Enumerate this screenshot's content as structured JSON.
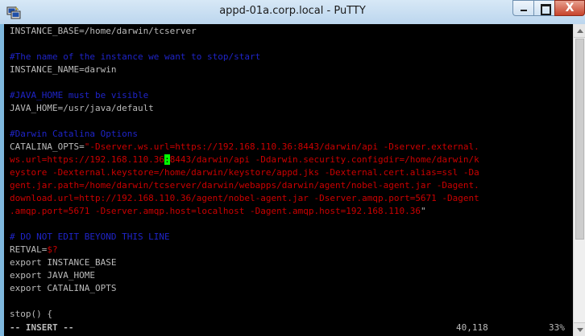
{
  "window": {
    "title": "appd-01a.corp.local - PuTTY",
    "icon": "putty-icon",
    "close_label": "X"
  },
  "terminal": {
    "lines": [
      {
        "segments": [
          {
            "cls": "w",
            "text": "INSTANCE_BASE=/home/darwin/tcserver"
          }
        ]
      },
      {
        "segments": []
      },
      {
        "segments": [
          {
            "cls": "c",
            "text": "#The name of the instance we want to stop/start"
          }
        ]
      },
      {
        "segments": [
          {
            "cls": "w",
            "text": "INSTANCE_NAME=darwin"
          }
        ]
      },
      {
        "segments": []
      },
      {
        "segments": [
          {
            "cls": "c",
            "text": "#JAVA_HOME must be visible"
          }
        ]
      },
      {
        "segments": [
          {
            "cls": "w",
            "text": "JAVA_HOME=/usr/java/default"
          }
        ]
      },
      {
        "segments": []
      },
      {
        "segments": [
          {
            "cls": "c",
            "text": "#Darwin Catalina Options"
          }
        ]
      },
      {
        "segments": [
          {
            "cls": "w",
            "text": "CATALINA_OPTS="
          },
          {
            "cls": "r",
            "text": "\"-Dserver.ws.url=https://192.168.110.36:8443/darwin/api -Dserver.external."
          }
        ]
      },
      {
        "segments": [
          {
            "cls": "r",
            "text": "ws.url=https://192.168.110.36"
          },
          {
            "cls": "cursor",
            "text": ":"
          },
          {
            "cls": "r",
            "text": "8443/darwin/api -Ddarwin.security.configdir=/home/darwin/k"
          }
        ]
      },
      {
        "segments": [
          {
            "cls": "r",
            "text": "eystore -Dexternal.keystore=/home/darwin/keystore/appd.jks -Dexternal.cert.alias=ssl -Da"
          }
        ]
      },
      {
        "segments": [
          {
            "cls": "r",
            "text": "gent.jar.path=/home/darwin/tcserver/darwin/webapps/darwin/agent/nobel-agent.jar -Dagent."
          }
        ]
      },
      {
        "segments": [
          {
            "cls": "r",
            "text": "download.url=http://192.168.110.36/agent/nobel-agent.jar -Dserver.amqp.port=5671 -Dagent"
          }
        ]
      },
      {
        "segments": [
          {
            "cls": "r",
            "text": ".amqp.port=5671 -Dserver.amqp.host=localhost -Dagent.amqp.host=192.168.110.36"
          },
          {
            "cls": "w",
            "text": "\""
          }
        ]
      },
      {
        "segments": []
      },
      {
        "segments": [
          {
            "cls": "c",
            "text": "# DO NOT EDIT BEYOND THIS LINE"
          }
        ]
      },
      {
        "segments": [
          {
            "cls": "w",
            "text": "RETVAL="
          },
          {
            "cls": "r",
            "text": "$?"
          }
        ]
      },
      {
        "segments": [
          {
            "cls": "w",
            "text": "export INSTANCE_BASE"
          }
        ]
      },
      {
        "segments": [
          {
            "cls": "w",
            "text": "export JAVA_HOME"
          }
        ]
      },
      {
        "segments": [
          {
            "cls": "w",
            "text": "export CATALINA_OPTS"
          }
        ]
      },
      {
        "segments": []
      },
      {
        "segments": [
          {
            "cls": "w",
            "text": "stop() {"
          }
        ]
      }
    ],
    "status_mode": "-- INSERT --",
    "cursor_position": "40,118",
    "scroll_percent": "33%"
  },
  "colors": {
    "background": "#000000",
    "text": "#bbbbbb",
    "comment": "#1f24c8",
    "string": "#cc0000",
    "cursor": "#00ff00"
  }
}
